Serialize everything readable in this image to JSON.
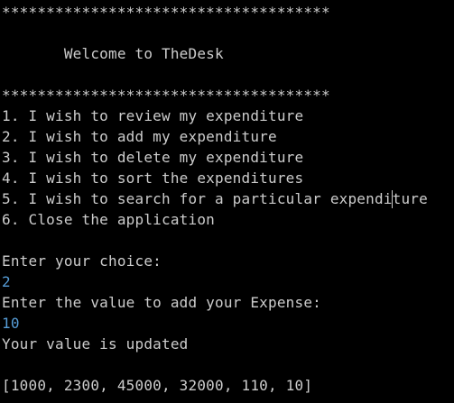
{
  "console": {
    "separator_top": "*************************************",
    "welcome": "       Welcome to TheDesk",
    "separator_bottom": "*************************************",
    "menu": [
      "1. I wish to review my expenditure",
      "2. I wish to add my expenditure",
      "3. I wish to delete my expenditure",
      "4. I wish to sort the expenditures",
      "5. I wish to search for a particular expenditure",
      "6. Close the application"
    ],
    "choice_prompt": "Enter your choice:",
    "choice_input": "2",
    "value_prompt": "Enter the value to add your Expense:",
    "value_input": "10",
    "status_message": "Your value is updated",
    "expenses_list": "[1000, 2300, 45000, 32000, 110, 10]"
  },
  "colors": {
    "background": "#000000",
    "text": "#cccccc",
    "user_input": "#569cd6"
  }
}
